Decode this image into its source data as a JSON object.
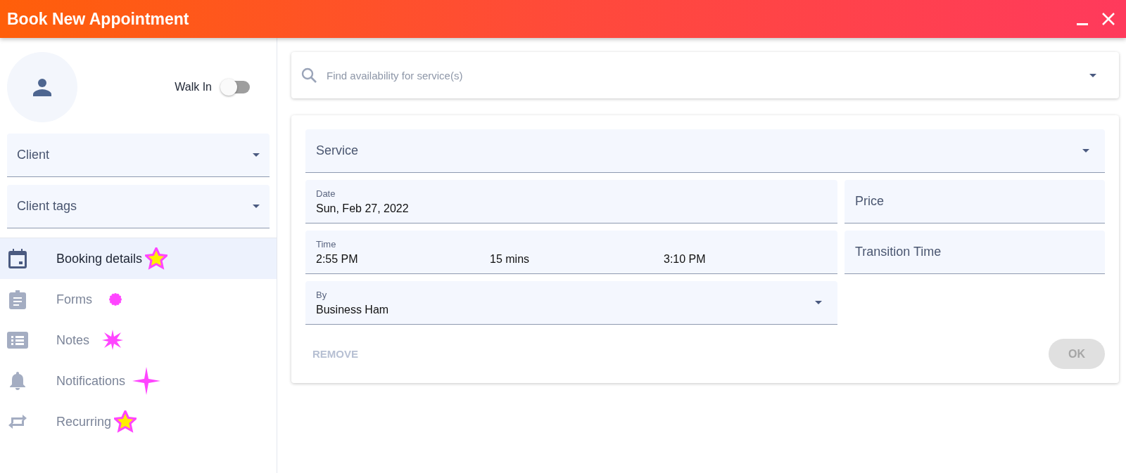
{
  "window": {
    "title": "Book New Appointment"
  },
  "sidebar": {
    "walk_in": {
      "label": "Walk In",
      "on": false
    },
    "fields": [
      {
        "placeholder": "Client"
      },
      {
        "placeholder": "Client tags"
      }
    ],
    "nav": [
      {
        "label": "Booking details",
        "selected": true,
        "kind": "star"
      },
      {
        "label": "Forms",
        "selected": false,
        "kind": "burst"
      },
      {
        "label": "Notes",
        "selected": false,
        "kind": "spark"
      },
      {
        "label": "Notifications",
        "selected": false,
        "kind": "twinkle"
      },
      {
        "label": "Recurring",
        "selected": false,
        "kind": "star"
      }
    ]
  },
  "search": {
    "placeholder": "Find availability for service(s)"
  },
  "form": {
    "service": {
      "placeholder": "Service"
    },
    "date": {
      "label": "Date",
      "value": "Sun, Feb 27, 2022"
    },
    "price": {
      "placeholder": "Price"
    },
    "time": {
      "label": "Time",
      "start": "2:55 PM",
      "duration": "15 mins",
      "end": "3:10 PM"
    },
    "transition": {
      "placeholder": "Transition Time"
    },
    "by": {
      "label": "By",
      "value": "Business Ham"
    },
    "remove": {
      "label": "REMOVE",
      "disabled": true
    },
    "ok": {
      "label": "OK",
      "disabled": true
    }
  }
}
